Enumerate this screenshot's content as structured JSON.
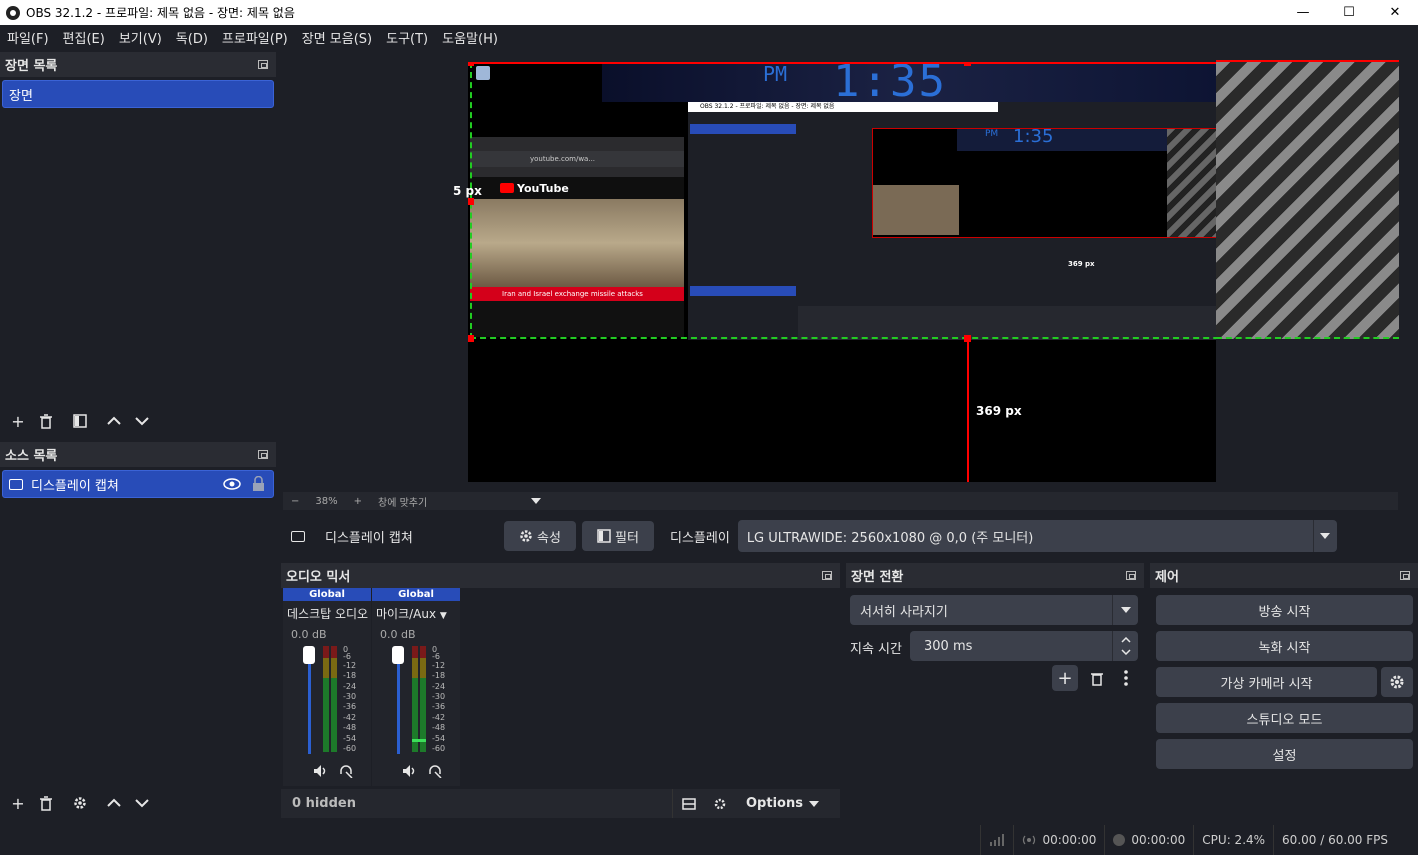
{
  "window": {
    "title": "OBS 32.1.2 - 프로파일: 제목 없음 - 장면: 제목 없음",
    "minimize": "—",
    "maximize": "☐",
    "close": "✕"
  },
  "menu": [
    "파일(F)",
    "편집(E)",
    "보기(V)",
    "독(D)",
    "프로파일(P)",
    "장면 모음(S)",
    "도구(T)",
    "도움말(H)"
  ],
  "scenes": {
    "header": "장면 목록",
    "items": [
      "장면"
    ]
  },
  "sources": {
    "header": "소스 목록",
    "items": [
      "디스플레이 캡쳐"
    ]
  },
  "preview": {
    "offset_left": "5 px",
    "offset_bottom": "369 px",
    "inner_offset": "369 px",
    "clock_pm": "PM",
    "clock_time": "1:35",
    "youtube_headline": "Iran and Israel exchange missile attacks",
    "youtube_logo": "YouTube",
    "youtube_url": "youtube.com/wa...",
    "inner_title": "OBS 32.1.2 - 프로파일: 제목 없음 - 장면: 제목 없음",
    "inner_clock_pm": "PM",
    "inner_clock_time": "1:35"
  },
  "zoom": {
    "minus": "−",
    "value": "38%",
    "plus": "+",
    "fit": "창에 맞추기"
  },
  "context": {
    "source_name": "디스플레이 캡쳐",
    "properties_label": "속성",
    "filters_label": "필터",
    "display_label": "디스플레이",
    "display_value": "LG ULTRAWIDE: 2560x1080 @ 0,0 (주 모니터)"
  },
  "mixer": {
    "header": "오디오 믹서",
    "channels": [
      {
        "global": "Global",
        "name": "데스크탑 오디오",
        "db": "0.0 dB",
        "level": 0
      },
      {
        "global": "Global",
        "name": "마이크/Aux",
        "db": "0.0 dB",
        "level": 0.1
      }
    ],
    "scale": [
      "0",
      "-6",
      "-12",
      "-18",
      "-24",
      "-30",
      "-36",
      "-42",
      "-48",
      "-54",
      "-60"
    ],
    "hidden": "0 hidden",
    "options": "Options"
  },
  "transitions": {
    "header": "장면 전환",
    "selected": "서서히 사라지기",
    "duration_label": "지속 시간",
    "duration_value": "300 ms"
  },
  "controls": {
    "header": "제어",
    "stream": "방송 시작",
    "record": "녹화 시작",
    "virtualcam": "가상 카메라 시작",
    "studio": "스튜디오 모드",
    "settings": "설정"
  },
  "status": {
    "stream_time": "00:00:00",
    "record_time": "00:00:00",
    "cpu": "CPU: 2.4%",
    "fps": "60.00 / 60.00 FPS"
  },
  "colors": {
    "accent": "#284cb8",
    "panel": "#1d1f26",
    "selection_red": "#ff0000",
    "selection_green": "#22cc22"
  }
}
